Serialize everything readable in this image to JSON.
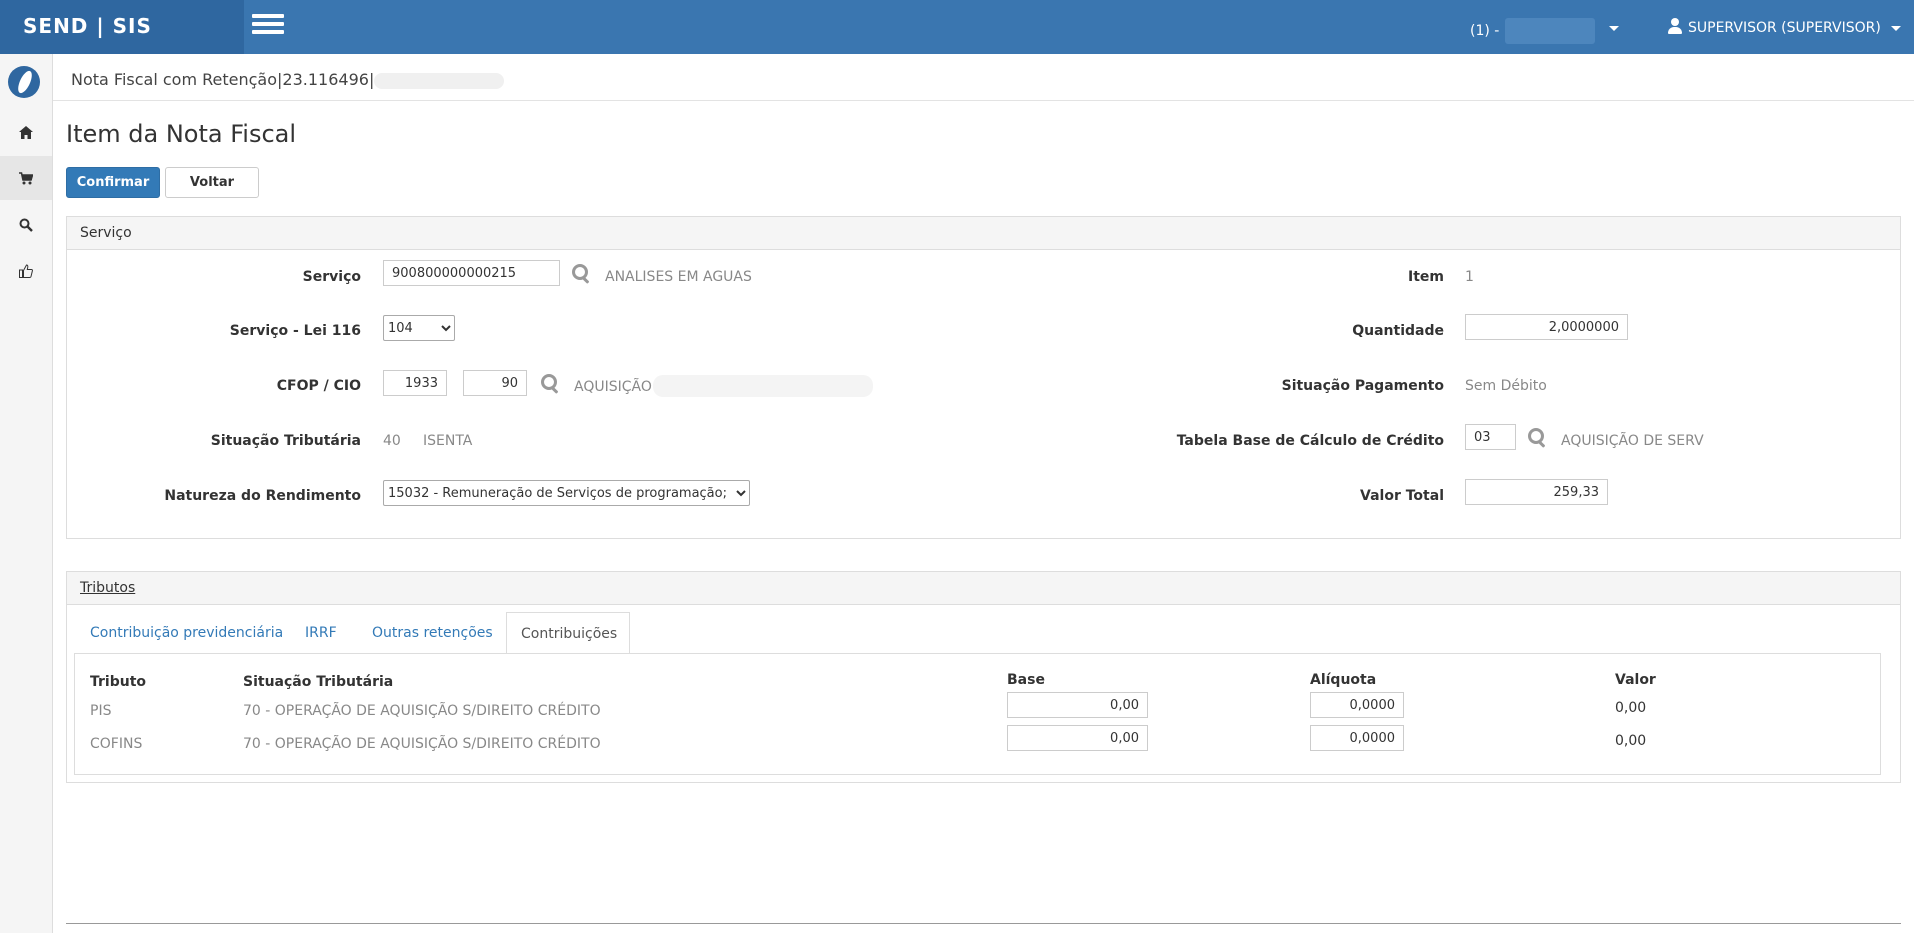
{
  "header": {
    "brand": "SEND | SIS",
    "org_label": "(1) -",
    "user_label": "SUPERVISOR (SUPERVISOR)"
  },
  "sidebar": {
    "items": [
      {
        "icon": "home-icon"
      },
      {
        "icon": "cart-icon"
      },
      {
        "icon": "search-icon"
      },
      {
        "icon": "thumbs-up-icon"
      }
    ]
  },
  "breadcrumb": "Nota Fiscal com Retenção|23.116496|",
  "page": {
    "title": "Item da Nota Fiscal",
    "confirm_label": "Confirmar",
    "back_label": "Voltar"
  },
  "servico_panel": {
    "heading": "Serviço",
    "servico_label": "Serviço",
    "servico_value": "900800000000215",
    "servico_desc": "ANALISES EM AGUAS",
    "lei116_label": "Serviço - Lei 116",
    "lei116_value": "104",
    "cfop_label": "CFOP / CIO",
    "cfop_value": "1933",
    "cio_value": "90",
    "cfop_desc": "AQUISIÇÃO",
    "sit_trib_label": "Situação Tributária",
    "sit_trib_code": "40",
    "sit_trib_desc": "ISENTA",
    "natureza_label": "Natureza do Rendimento",
    "natureza_value": "15032 - Remuneração de Serviços de programação;",
    "item_label": "Item",
    "item_value": "1",
    "quantidade_label": "Quantidade",
    "quantidade_value": "2,0000000",
    "sit_pag_label": "Situação Pagamento",
    "sit_pag_value": "Sem Débito",
    "tabela_label": "Tabela Base de Cálculo de Crédito",
    "tabela_value": "03",
    "tabela_desc": "AQUISIÇÃO DE SERV",
    "valor_total_label": "Valor Total",
    "valor_total_value": "259,33"
  },
  "tributos_panel": {
    "heading": "Tributos",
    "tabs": [
      {
        "label": "Contribuição previdenciária"
      },
      {
        "label": "IRRF"
      },
      {
        "label": "Outras retenções"
      },
      {
        "label": "Contribuições"
      }
    ],
    "columns": {
      "tributo": "Tributo",
      "situacao": "Situação Tributária",
      "base": "Base",
      "aliquota": "Alíquota",
      "valor": "Valor"
    },
    "rows": [
      {
        "tributo": "PIS",
        "situacao": "70 - OPERAÇÃO DE AQUISIÇÃO S/DIREITO CRÉDITO",
        "base": "0,00",
        "aliquota": "0,0000",
        "valor": "0,00"
      },
      {
        "tributo": "COFINS",
        "situacao": "70 - OPERAÇÃO DE AQUISIÇÃO S/DIREITO CRÉDITO",
        "base": "0,00",
        "aliquota": "0,0000",
        "valor": "0,00"
      }
    ]
  }
}
